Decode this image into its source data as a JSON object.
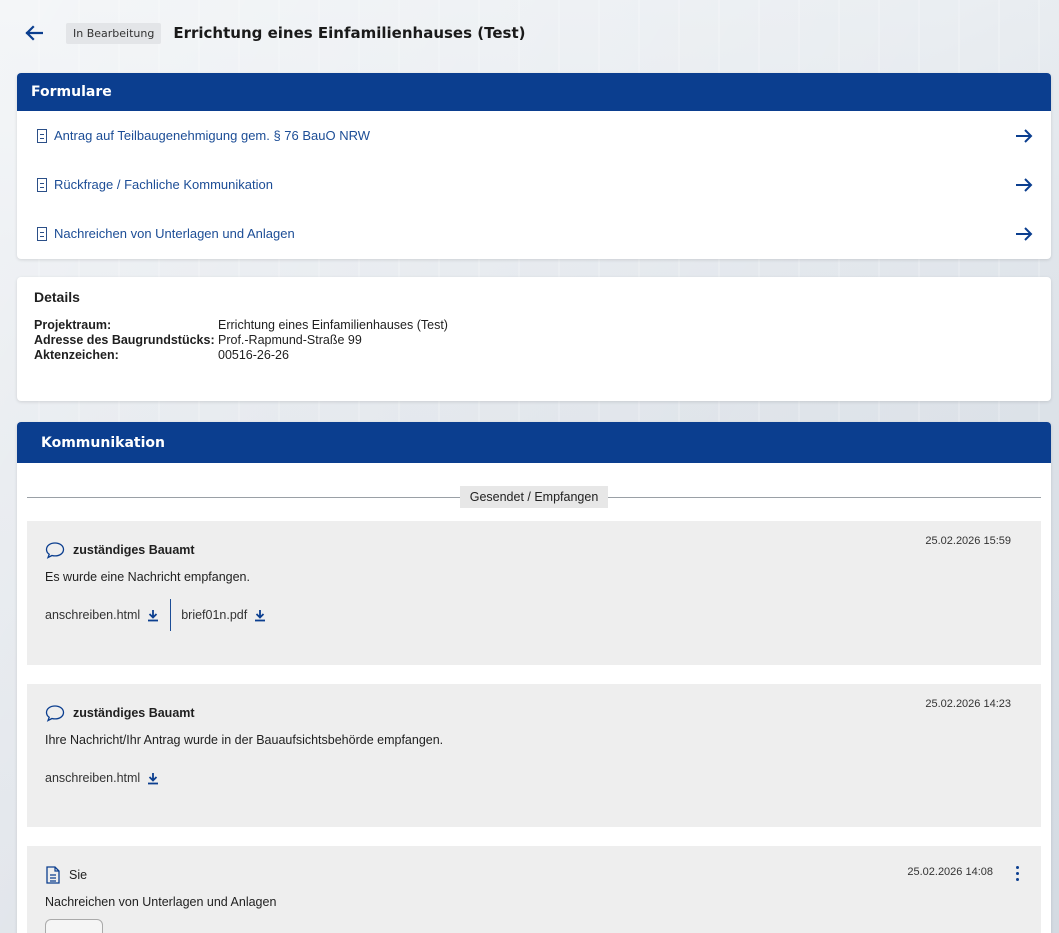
{
  "header": {
    "status": "In Bearbeitung",
    "title": "Errichtung eines Einfamilienhauses (Test)"
  },
  "forms": {
    "heading": "Formulare",
    "items": [
      {
        "label": "Antrag auf Teilbaugenehmigung gem. § 76 BauO NRW"
      },
      {
        "label": "Rückfrage / Fachliche Kommunikation"
      },
      {
        "label": "Nachreichen von Unterlagen und Anlagen"
      }
    ]
  },
  "details": {
    "heading": "Details",
    "rows": [
      {
        "key": "Projektraum:",
        "value": "Errichtung eines Einfamilienhauses (Test)"
      },
      {
        "key": "Adresse des Baugrundstücks:",
        "value": "Prof.-Rapmund-Straße  99"
      },
      {
        "key": "Aktenzeichen:",
        "value": "00516-26-26"
      }
    ]
  },
  "communication": {
    "heading": "Kommunikation",
    "filter_label": "Gesendet / Empfangen",
    "messages": [
      {
        "sender": "zuständiges Bauamt",
        "date": "25.02.2026 15:59",
        "text": "Es wurde eine Nachricht empfangen.",
        "files": [
          "anschreiben.html",
          "brief01n.pdf"
        ]
      },
      {
        "sender": "zuständiges Bauamt",
        "date": "25.02.2026 14:23",
        "text": "Ihre Nachricht/Ihr Antrag wurde in der Bauaufsichtsbehörde empfangen.",
        "files": [
          "anschreiben.html"
        ]
      },
      {
        "sender": "Sie",
        "date": "25.02.2026 14:08",
        "text": "Nachreichen von Unterlagen und Anlagen",
        "files": []
      }
    ]
  },
  "colors": {
    "primary": "#0b3e8f",
    "link": "#1c4d96",
    "message_bg": "#eeeeee"
  },
  "icons": {
    "back": "arrow-left-icon",
    "form": "form-document-icon",
    "go": "arrow-right-icon",
    "message": "speech-bubble-icon",
    "document": "document-icon",
    "download": "download-icon",
    "more": "kebab-menu-icon"
  }
}
